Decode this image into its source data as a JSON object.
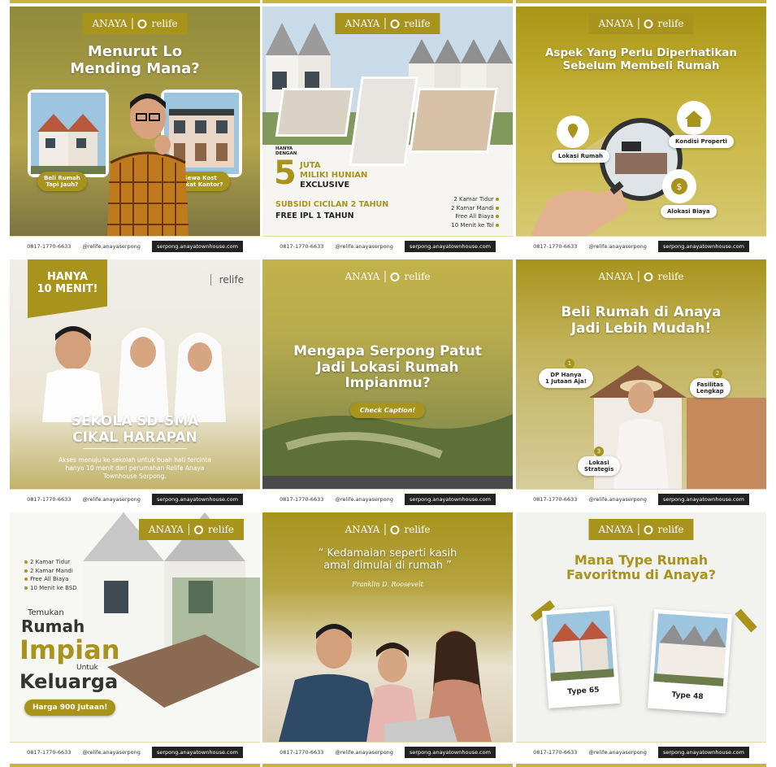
{
  "brand": {
    "anaya": "ANAYA",
    "relife": "relife"
  },
  "footer": {
    "phone": "0817-1770-6633",
    "ig": "@relife.anayaserpong",
    "web": "serpong.anayatownhouse.com"
  },
  "tiles": [
    {
      "headline": "Menurut Lo\nMending Mana?",
      "left_label": "Beli Rumah\nTapi Jauh?",
      "right_label": "Sewa Kost\nDekat Kantor?"
    },
    {
      "tag": "HANYA\nDENGAN",
      "big_num": "5",
      "price_line1": "JUTA",
      "price_line2": "MILIKI HUNIAN",
      "price_line3": "EXCLUSIVE",
      "promo1": "SUBSIDI CICILAN 2 TAHUN",
      "promo2": "FREE IPL 1 TAHUN",
      "features": [
        "2 Kamar Tidur",
        "2 Kamar Mandi",
        "Free All Biaya",
        "10 Menit ke Tol"
      ]
    },
    {
      "headline": "Aspek Yang Perlu Diperhatikan\nSebelum Membeli Rumah",
      "icons": [
        "Lokasi Rumah",
        "Kondisi Properti",
        "Alokasi Biaya"
      ]
    },
    {
      "badge": "HANYA\n10 MENIT!",
      "headline": "SEKOLA SD-SMA\nCIKAL HARAPAN",
      "desc": "Akses menuju ke sekolah untuk buah hati tercinta\nhanya 10 menit dari perumahan Relife Anaya\nTownhouse Serpong."
    },
    {
      "headline": "Mengapa Serpong Patut\nJadi Lokasi Rumah\nImpianmu?",
      "cta": "Check Caption!"
    },
    {
      "headline": "Beli Rumah di Anaya\nJadi Lebih Mudah!",
      "points": [
        {
          "n": "1",
          "t": "DP Hanya\n1 Jutaan Aja!"
        },
        {
          "n": "2",
          "t": "Fasilitas\nLengkap"
        },
        {
          "n": "3",
          "t": "Lokasi\nStrategis"
        }
      ]
    },
    {
      "features": [
        "2 Kamar Tidur",
        "2 Kamar Mandi",
        "Free All Biaya",
        "10 Menit ke BSD"
      ],
      "l1": "Temukan",
      "l2": "Rumah",
      "l3": "Impian",
      "l4": "Untuk",
      "l5": "Keluarga",
      "price": "Harga 900 Jutaan!"
    },
    {
      "quote": "“ Kedamaian seperti kasih\namal dimulai di rumah ”",
      "author": "Franklin D. Roosevelt"
    },
    {
      "headline": "Mana Type Rumah\nFavoritmu di Anaya?",
      "type_a": "Type 65",
      "type_b": "Type 48"
    }
  ],
  "colors": {
    "olive": "#a8931c",
    "olive_light": "#c6b33b",
    "cream": "#f2f2ef"
  }
}
